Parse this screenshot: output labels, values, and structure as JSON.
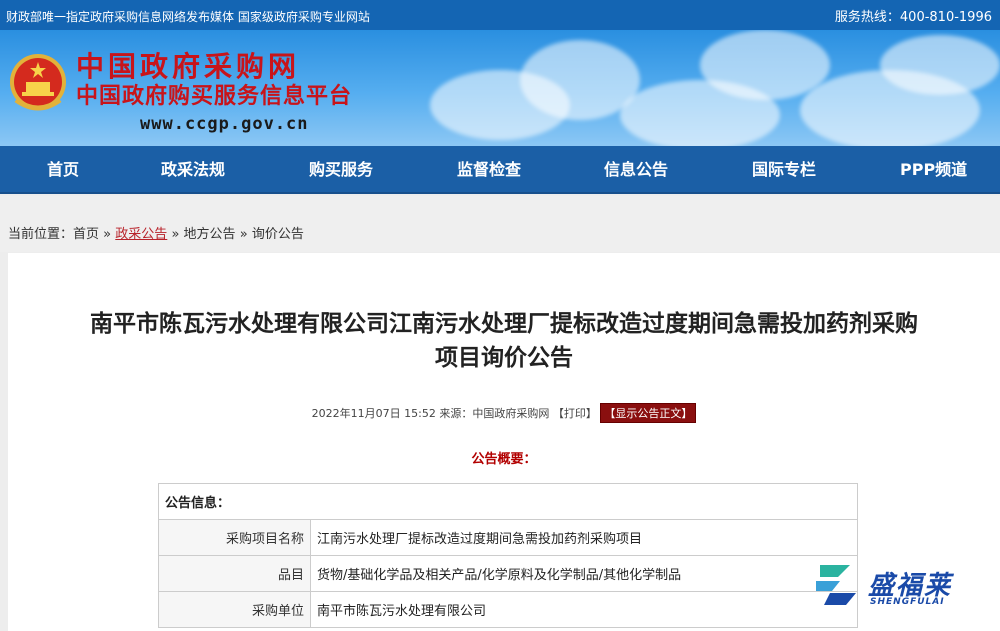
{
  "topbar": {
    "left_text": "财政部唯一指定政府采购信息网络发布媒体 国家级政府采购专业网站",
    "right_text": "服务热线：400-810-1996"
  },
  "header": {
    "logo_line1": "中国政府采购网",
    "logo_line2": "中国政府购买服务信息平台",
    "url": "www.ccgp.gov.cn"
  },
  "nav": {
    "items": [
      "首页",
      "政采法规",
      "购买服务",
      "监督检查",
      "信息公告",
      "国际专栏",
      "PPP频道"
    ]
  },
  "breadcrumb": {
    "prefix": "当前位置：",
    "items": [
      "首页",
      "政采公告",
      "地方公告",
      "询价公告"
    ],
    "separator": "»"
  },
  "article": {
    "title_line1": "南平市陈瓦污水处理有限公司江南污水处理厂提标改造过度期间急需投加药剂采购",
    "title_line2": "项目询价公告",
    "date": "2022年11月07日 15:52",
    "source": "来源：中国政府采购网",
    "print": "【打印】",
    "show_text": "【显示公告正文】",
    "summary_label": "公告概要："
  },
  "table": {
    "header": "公告信息：",
    "rows": [
      {
        "label": "采购项目名称",
        "value": "江南污水处理厂提标改造过度期间急需投加药剂采购项目"
      },
      {
        "label": "品目",
        "value": "货物/基础化学品及相关产品/化学原料及化学制品/其他化学制品"
      },
      {
        "label": "采购单位",
        "value": "南平市陈瓦污水处理有限公司"
      }
    ]
  },
  "watermark": {
    "text_cn": "盛福莱",
    "text_en": "SHENGFULAI"
  },
  "colors": {
    "brand_blue": "#1465b3",
    "nav_blue": "#1b5fa6",
    "logo_red": "#c8141a",
    "summary_red": "#b20000"
  }
}
